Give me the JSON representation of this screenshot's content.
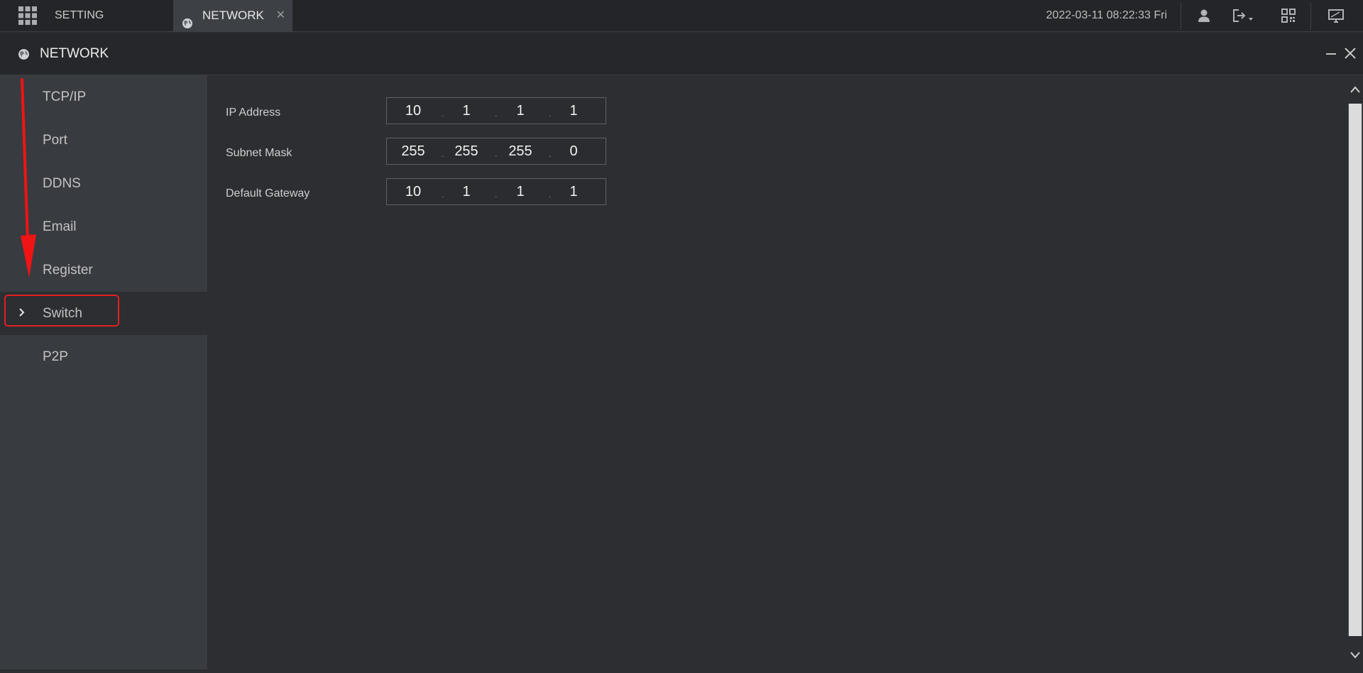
{
  "topbar": {
    "setting_label": "SETTING",
    "network_tab_label": "NETWORK",
    "datetime": "2022-03-11 08:22:33 Fri",
    "icons": [
      "grid-menu-icon",
      "globe-icon",
      "close-icon",
      "user-icon",
      "logout-icon",
      "qr-code-icon",
      "monitor-icon"
    ]
  },
  "window": {
    "title": "NETWORK"
  },
  "sidebar": {
    "items": [
      {
        "label": "TCP/IP"
      },
      {
        "label": "Port"
      },
      {
        "label": "DDNS"
      },
      {
        "label": "Email"
      },
      {
        "label": "Register"
      },
      {
        "label": "Switch",
        "active": true
      },
      {
        "label": "P2P"
      }
    ]
  },
  "form": {
    "ip_address": {
      "label": "IP Address",
      "octets": [
        "10",
        "1",
        "1",
        "1"
      ]
    },
    "subnet_mask": {
      "label": "Subnet Mask",
      "octets": [
        "255",
        "255",
        "255",
        "0"
      ]
    },
    "default_gateway": {
      "label": "Default Gateway",
      "octets": [
        "10",
        "1",
        "1",
        "1"
      ]
    }
  },
  "colors": {
    "accent_red": "#e0221f",
    "background": "#2c2e32",
    "sidebar": "#383b40"
  }
}
